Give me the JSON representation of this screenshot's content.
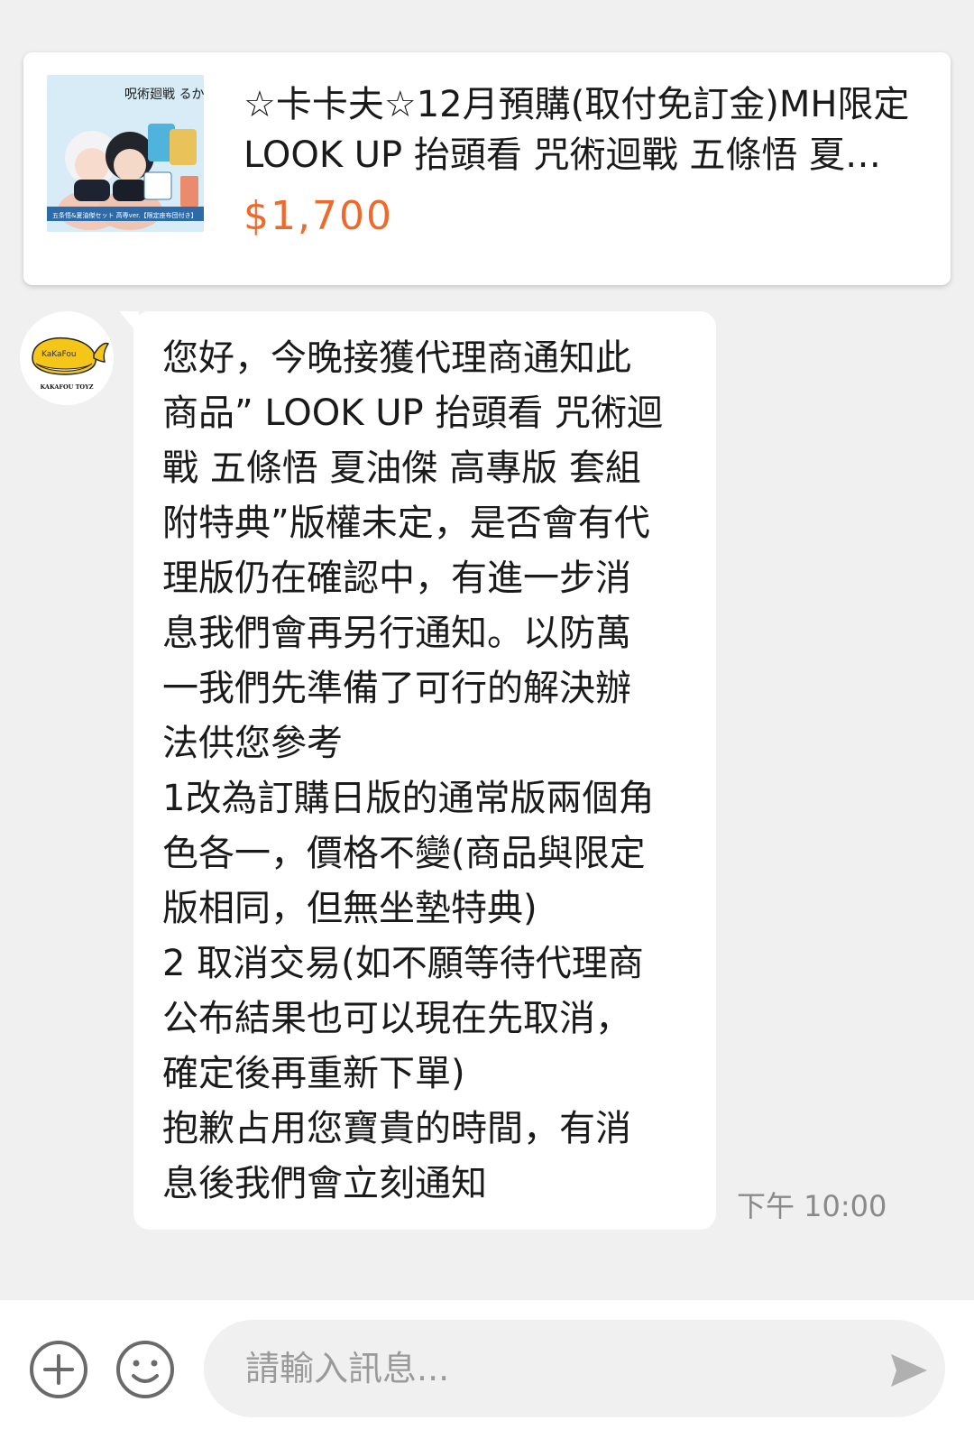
{
  "product": {
    "title": "☆卡卡夫☆12月預購(取付免訂金)MH限定 LOOK UP 抬頭看 咒術迴戰 五條悟 夏油傑 高專版 套組 附特典",
    "price": "$1,700",
    "image_text": "呪術廻戦 るかっぷ",
    "image_caption": "五条悟&夏油傑セット 高専ver.【限定座布団付き】"
  },
  "shop": {
    "avatar_text": "KAKAFOU TOYZ"
  },
  "message": {
    "lines": [
      "您好，今晚接獲代理商通知此",
      "商品” LOOK UP 抬頭看 咒術迴",
      "戰 五條悟 夏油傑 高專版 套組",
      "附特典”版權未定，是否會有代",
      "理版仍在確認中，有進一步消",
      "息我們會再另行通知。以防萬",
      "一我們先準備了可行的解決辦",
      "法供您參考",
      "1改為訂購日版的通常版兩個角",
      "色各一，價格不變(商品與限定",
      "版相同，但無坐墊特典)",
      "2 取消交易(如不願等待代理商",
      "公布結果也可以現在先取消，",
      "確定後再重新下單)",
      "抱歉占用您寶貴的時間，有消",
      "息後我們會立刻通知"
    ],
    "time": "下午 10:00"
  },
  "input": {
    "placeholder": "請輸入訊息..."
  },
  "icons": {
    "plus": "plus-circle-icon",
    "emoji": "smiley-icon",
    "send": "send-arrow-icon"
  },
  "colors": {
    "price": "#ee6a2c",
    "background": "#f0f0f0",
    "bubble": "#ffffff",
    "timestamp": "#8a8a8a"
  }
}
